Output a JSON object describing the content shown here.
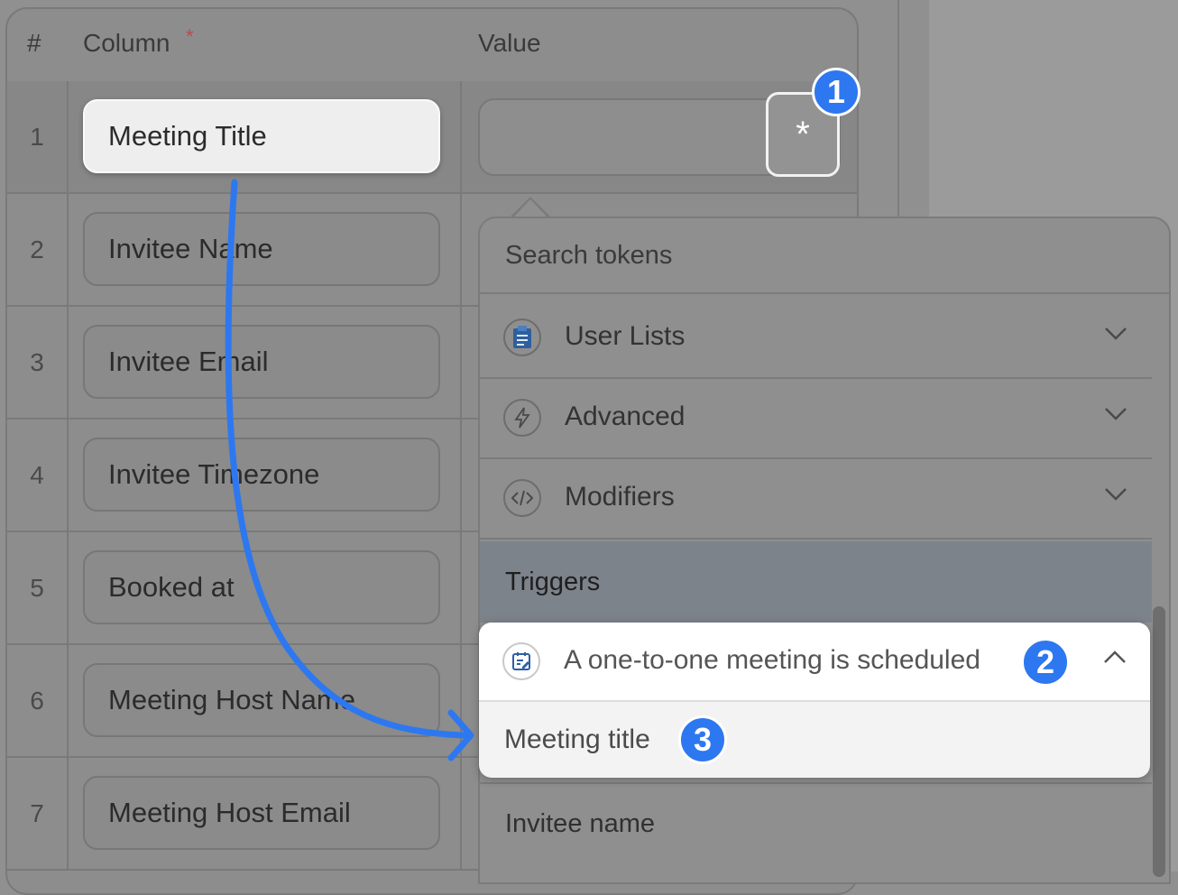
{
  "table": {
    "header": {
      "num": "#",
      "column": "Column",
      "required": "*",
      "value": "Value"
    },
    "rows": [
      {
        "num": "1",
        "column": "Meeting Title"
      },
      {
        "num": "2",
        "column": "Invitee Name"
      },
      {
        "num": "3",
        "column": "Invitee Email"
      },
      {
        "num": "4",
        "column": "Invitee Timezone"
      },
      {
        "num": "5",
        "column": "Booked at"
      },
      {
        "num": "6",
        "column": "Meeting Host Name"
      },
      {
        "num": "7",
        "column": "Meeting Host Email"
      }
    ],
    "token_button_label": "*"
  },
  "dropdown": {
    "search_placeholder": "Search tokens",
    "sections": [
      {
        "label": "User Lists",
        "icon": "clipboard-icon"
      },
      {
        "label": "Advanced",
        "icon": "lightning-icon"
      },
      {
        "label": "Modifiers",
        "icon": "code-icon"
      }
    ],
    "triggers_label": "Triggers",
    "trigger_group": {
      "label": "A one-to-one meeting is scheduled",
      "icon": "calendar-edit-icon"
    },
    "trigger_items": [
      "Meeting title",
      "Invitee name"
    ]
  },
  "badges": [
    "1",
    "2",
    "3"
  ],
  "colors": {
    "accent": "#2d78f0",
    "triggers_bg": "#7d838b"
  }
}
